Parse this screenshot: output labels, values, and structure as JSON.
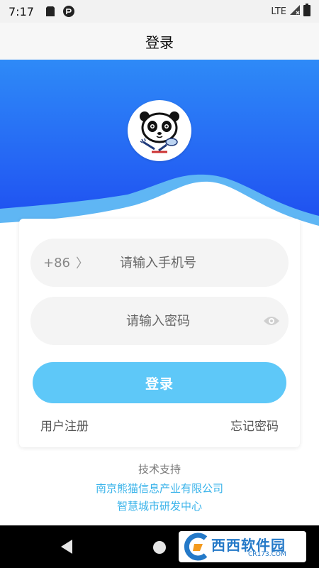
{
  "status_bar": {
    "time": "7:17",
    "network": "LTE",
    "icons": [
      "sd-card-icon",
      "app-notification-icon",
      "signal-icon",
      "battery-icon"
    ]
  },
  "app_bar": {
    "title": "登录"
  },
  "hero": {
    "logo_icon": "panda-chef-logo-icon",
    "colors": {
      "top": "#2e8af7",
      "bottom": "#1e4cef",
      "wave_light": "#5fb6f4"
    }
  },
  "login_form": {
    "country_code": "+86",
    "chevron": "〉",
    "phone_placeholder": "请输入手机号",
    "password_placeholder": "请输入密码",
    "login_button": "登录",
    "register_link": "用户注册",
    "forgot_link": "忘记密码",
    "accent_color": "#5ec8f8"
  },
  "footer": {
    "support_label": "技术支持",
    "company_line1": "南京熊猫信息产业有限公司",
    "company_line2": "智慧城市研发中心"
  },
  "watermark": {
    "text": "西西软件园",
    "sub": "CR173.COM"
  }
}
